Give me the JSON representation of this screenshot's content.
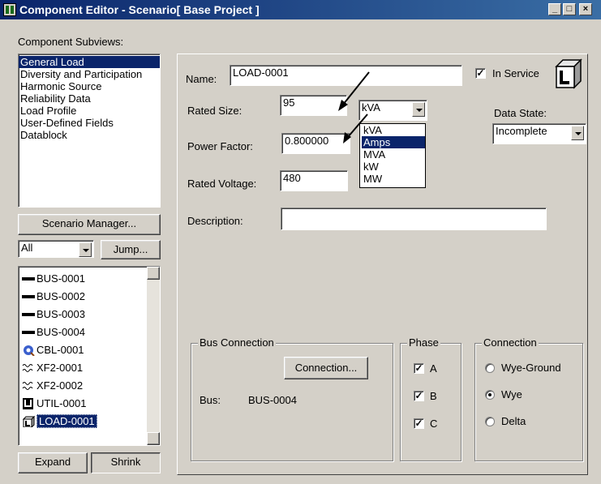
{
  "window": {
    "title": "Component Editor  - Scenario[ Base Project ]",
    "buttons": [
      "_",
      "□",
      "×"
    ]
  },
  "left": {
    "subviews_label": "Component Subviews:",
    "subviews": [
      {
        "label": "General Load",
        "selected": true
      },
      {
        "label": "Diversity and Participation",
        "selected": false
      },
      {
        "label": "Harmonic Source",
        "selected": false
      },
      {
        "label": "Reliability Data",
        "selected": false
      },
      {
        "label": "Load Profile",
        "selected": false
      },
      {
        "label": "User-Defined Fields",
        "selected": false
      },
      {
        "label": "Datablock",
        "selected": false
      }
    ],
    "scenario_manager_label": "Scenario Manager...",
    "filter_value": "All",
    "jump_label": "Jump...",
    "components": [
      {
        "label": "BUS-0001",
        "icon": "bus-icon"
      },
      {
        "label": "BUS-0002",
        "icon": "bus-icon"
      },
      {
        "label": "BUS-0003",
        "icon": "bus-icon"
      },
      {
        "label": "BUS-0004",
        "icon": "bus-icon"
      },
      {
        "label": "CBL-0001",
        "icon": "cable-icon"
      },
      {
        "label": "XF2-0001",
        "icon": "transformer-icon"
      },
      {
        "label": "XF2-0002",
        "icon": "transformer-icon"
      },
      {
        "label": "UTIL-0001",
        "icon": "utility-icon"
      },
      {
        "label": "LOAD-0001",
        "icon": "load-icon",
        "selected": true
      }
    ],
    "expand_label": "Expand",
    "shrink_label": "Shrink"
  },
  "form": {
    "name_label": "Name:",
    "name_value": "LOAD-0001",
    "in_service_label": "In Service",
    "in_service_checked": true,
    "rated_size_label": "Rated Size:",
    "rated_size_value": "95",
    "unit_value": "kVA",
    "unit_options": [
      "kVA",
      "Amps",
      "MVA",
      "kW",
      "MW"
    ],
    "unit_highlighted": "Amps",
    "data_state_label": "Data State:",
    "data_state_value": "Incomplete",
    "power_factor_label": "Power Factor:",
    "power_factor_value": "0.800000",
    "rated_voltage_label": "Rated Voltage:",
    "rated_voltage_value": "480",
    "description_label": "Description:",
    "description_value": ""
  },
  "bus_connection": {
    "title": "Bus Connection",
    "button_label": "Connection...",
    "bus_label": "Bus:",
    "bus_value": "BUS-0004"
  },
  "phase": {
    "title": "Phase",
    "items": [
      {
        "label": "A",
        "checked": true
      },
      {
        "label": "B",
        "checked": true
      },
      {
        "label": "C",
        "checked": true
      }
    ]
  },
  "connection": {
    "title": "Connection",
    "options": [
      {
        "label": "Wye-Ground",
        "selected": false
      },
      {
        "label": "Wye",
        "selected": true
      },
      {
        "label": "Delta",
        "selected": false
      }
    ]
  },
  "colors": {
    "selection": "#0a246a",
    "face": "#d4d0c8"
  }
}
